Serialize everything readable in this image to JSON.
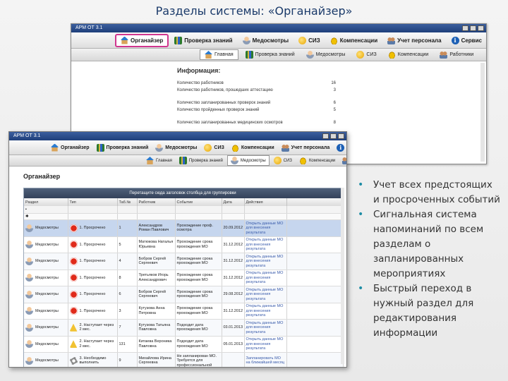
{
  "slide": {
    "title": "Разделы системы: «Органайзер»",
    "bullets": [
      "Учет всех предстоящих и просроченных событий",
      "Сигнальная система напоминаний по всем разделам о запланированных мероприятиях",
      "Быстрый переход в нужный раздел для редактирования информации"
    ]
  },
  "app": {
    "window_title": "АРМ ОТ 3.1",
    "main_tabs": [
      {
        "label": "Органайзер",
        "icon": "house-icon",
        "active": true
      },
      {
        "label": "Проверка знаний",
        "icon": "books-icon"
      },
      {
        "label": "Медосмотры",
        "icon": "doctor-icon"
      },
      {
        "label": "СИЗ",
        "icon": "egg-icon"
      },
      {
        "label": "Компенсации",
        "icon": "coins-icon"
      },
      {
        "label": "Учет персонала",
        "icon": "people-icon"
      },
      {
        "label": "Сервис",
        "icon": "info-icon"
      }
    ],
    "sub_tabs": [
      {
        "label": "Главная",
        "icon": "house-icon"
      },
      {
        "label": "Проверка знаний",
        "icon": "books-icon"
      },
      {
        "label": "Медосмотры",
        "icon": "doctor-icon"
      },
      {
        "label": "СИЗ",
        "icon": "egg-icon"
      },
      {
        "label": "Компенсации",
        "icon": "coins-icon"
      },
      {
        "label": "Работники",
        "icon": "people-icon"
      }
    ]
  },
  "info_panel": {
    "title": "Информация:",
    "rows": [
      {
        "label": "Количество работников",
        "value": "16"
      },
      {
        "label": "Количество работников, прошедших аттестацию",
        "value": "3"
      },
      {
        "label": "Количество запланированных проверок знаний",
        "value": "6"
      },
      {
        "label": "Количество пройденных проверок знаний",
        "value": "5"
      },
      {
        "label": "Количество запланированных медицинских осмотров",
        "value": "8"
      }
    ]
  },
  "organizer": {
    "title": "Органайзер",
    "group_hint": "Перетащите сюда заголовок столбца для группировки",
    "columns": [
      "Раздел",
      "Тип",
      "Таб.№",
      "Работник",
      "Событие",
      "Дата",
      "Действия"
    ],
    "rows": [
      {
        "section": "Медосмотры",
        "type": "1. Просрочено",
        "tab": "1",
        "worker": "Александров Роман Павлович",
        "event": "Прохождение проф. осмотра",
        "date": "20.09.2012",
        "action": "Открыть данные МО для внесения результата",
        "selected": true
      },
      {
        "section": "Медосмотры",
        "type": "1. Просрочено",
        "tab": "5",
        "worker": "Матюкова Наталья Юрьевна",
        "event": "Прохождение срока прохождения МО",
        "date": "31.12.2012",
        "action": "Открыть данные МО для внесения результата"
      },
      {
        "section": "Медосмотры",
        "type": "1. Просрочено",
        "tab": "4",
        "worker": "Бобров Сергей Сергеевич",
        "event": "Прохождение срока прохождения МО",
        "date": "31.12.2012",
        "action": "Открыть данные МО для внесения результата"
      },
      {
        "section": "Медосмотры",
        "type": "1. Просрочено",
        "tab": "8",
        "worker": "Третьяков Игорь Александрович",
        "event": "Прохождение срока прохождения МО",
        "date": "31.12.2012",
        "action": "Открыть данные МО для внесения результата"
      },
      {
        "section": "Медосмотры",
        "type": "1. Просрочено",
        "tab": "6",
        "worker": "Бобров Сергей Сергеевич",
        "event": "Прохождение срока прохождения МО",
        "date": "29.08.2012",
        "action": "Открыть данные МО для внесения результата"
      },
      {
        "section": "Медосмотры",
        "type": "1. Просрочено",
        "tab": "3",
        "worker": "Кутузова Анна Петровна",
        "event": "Прохождение срока прохождения МО",
        "date": "31.12.2012",
        "action": "Открыть данные МО для внесения результата"
      },
      {
        "section": "Медосмотры",
        "type": "2. Наступает через 2 мес.",
        "tab": "7",
        "worker": "Кутузова Татьяна Павловна",
        "event": "Подходит дата прохождения МО",
        "date": "03.01.2013",
        "action": "Открыть данные МО для внесения результата"
      },
      {
        "section": "Медосмотры",
        "type": "2. Наступает через 2 мес.",
        "tab": "131",
        "worker": "Китаева Вероника Павловна",
        "event": "Подходит дата прохождения МО",
        "date": "05.01.2013",
        "action": "Открыть данные МО для внесения результата"
      },
      {
        "section": "Медосмотры",
        "type": "3. Необходимо выполнить",
        "tab": "9",
        "worker": "Михайлова Ирина Сергеевна",
        "event": "Не запланирован МО. Требуется для профессиональной",
        "date": "",
        "action": "Запланировать МО на ближайшей месяц"
      }
    ]
  }
}
